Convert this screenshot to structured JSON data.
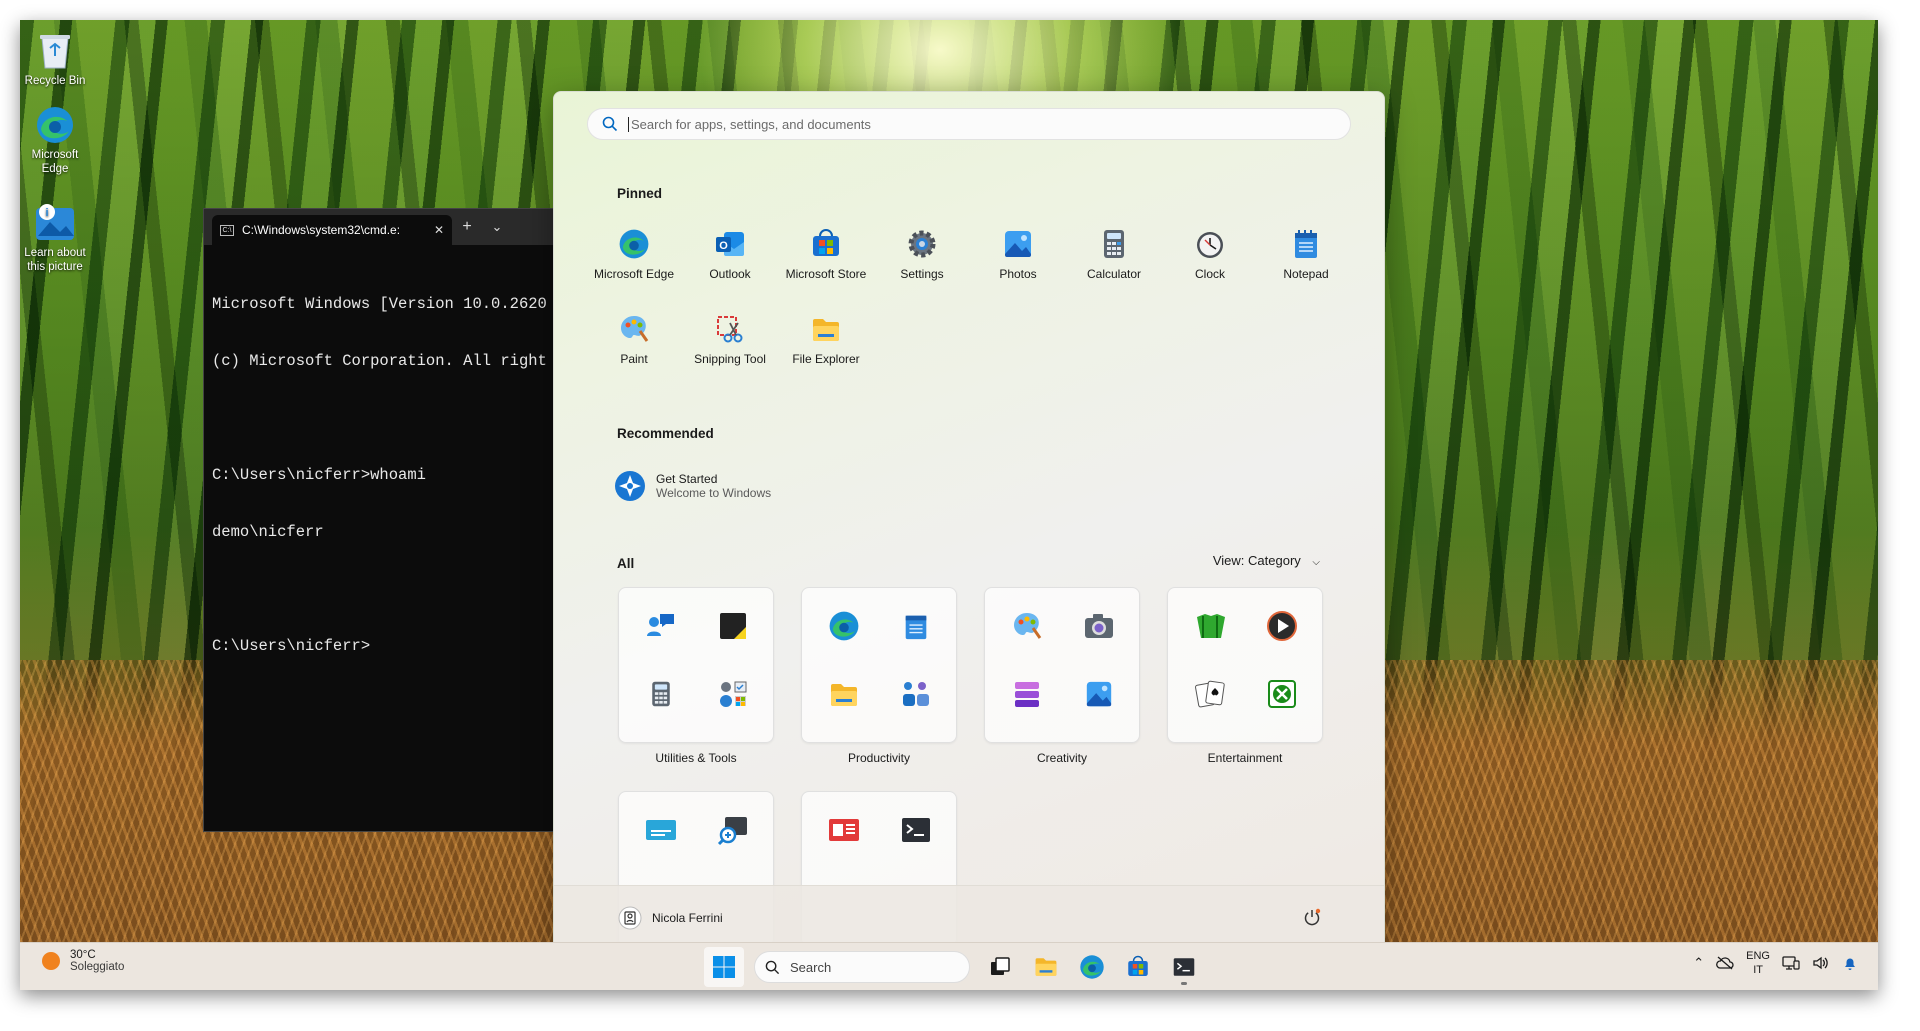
{
  "desktop": {
    "icons": [
      {
        "label": "Recycle Bin",
        "icon": "recycle-bin-icon"
      },
      {
        "label": "Microsoft Edge",
        "icon": "edge-icon"
      },
      {
        "label": "Learn about this picture",
        "icon": "learn-about-picture-icon"
      }
    ]
  },
  "terminal": {
    "tab_title": "C:\\Windows\\system32\\cmd.e:",
    "new_tab": "+",
    "dropdown": "⌄",
    "close": "✕",
    "lines": [
      "Microsoft Windows [Version 10.0.2620",
      "(c) Microsoft Corporation. All right",
      "",
      "C:\\Users\\nicferr>whoami",
      "demo\\nicferr",
      "",
      "C:\\Users\\nicferr>"
    ]
  },
  "start_menu": {
    "search_placeholder": "Search for apps, settings, and documents",
    "pinned_title": "Pinned",
    "pinned": [
      {
        "label": "Microsoft Edge",
        "icon": "edge-icon"
      },
      {
        "label": "Outlook",
        "icon": "outlook-icon"
      },
      {
        "label": "Microsoft Store",
        "icon": "store-icon"
      },
      {
        "label": "Settings",
        "icon": "gear-icon"
      },
      {
        "label": "Photos",
        "icon": "photos-icon"
      },
      {
        "label": "Calculator",
        "icon": "calculator-icon"
      },
      {
        "label": "Clock",
        "icon": "clock-icon"
      },
      {
        "label": "Notepad",
        "icon": "notepad-icon"
      },
      {
        "label": "Paint",
        "icon": "paint-icon"
      },
      {
        "label": "Snipping Tool",
        "icon": "snipping-tool-icon"
      },
      {
        "label": "File Explorer",
        "icon": "folder-icon"
      }
    ],
    "recommended_title": "Recommended",
    "recommended": {
      "title": "Get Started",
      "subtitle": "Welcome to Windows",
      "icon": "get-started-icon"
    },
    "all_title": "All",
    "view_label": "View: Category",
    "categories": [
      {
        "label": "Utilities & Tools",
        "icons": [
          "get-help-icon",
          "sticky-notes-icon",
          "calculator-icon",
          "control-panel-icon"
        ]
      },
      {
        "label": "Productivity",
        "icons": [
          "edge-icon",
          "notepad-icon",
          "folder-icon",
          "teams-icon"
        ]
      },
      {
        "label": "Creativity",
        "icons": [
          "paint-icon",
          "camera-icon",
          "clipchamp-icon",
          "photos-icon"
        ]
      },
      {
        "label": "Entertainment",
        "icons": [
          "solitaire-icon",
          "media-player-icon",
          "cards-icon",
          "xbox-icon"
        ]
      },
      {
        "label": "",
        "icons": [
          "captions-icon",
          "magnifier-icon"
        ]
      },
      {
        "label": "",
        "icons": [
          "news-icon",
          "terminal-icon"
        ]
      }
    ],
    "user_name": "Nicola Ferrini",
    "power_icon": "power-icon"
  },
  "taskbar": {
    "weather_temp": "30°C",
    "weather_desc": "Soleggiato",
    "search_label": "Search",
    "lang_top": "ENG",
    "lang_bottom": "IT",
    "colors": {
      "accent": "#0078d4",
      "taskbar_bg": "#ece6df"
    }
  }
}
